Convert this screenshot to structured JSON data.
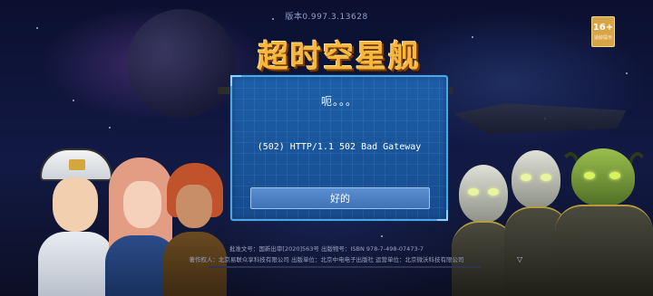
{
  "version_text": "版本0.997.3.13628",
  "age_rating": {
    "label": "16+",
    "sublabel": "适龄提示"
  },
  "game_logo": "超时空星舰",
  "dialog": {
    "title": "呃。。。",
    "message": "(502) HTTP/1.1 502 Bad Gateway",
    "ok_button": "好的"
  },
  "footer": {
    "line1": "批准文号：国新出审[2020]563号 出版物号：ISBN 978-7-498-07473-7",
    "line2": "著作权人：北京易联众享科技有限公司 出版单位：北京中电电子出版社 运营单位：北京微沃科技有限公司"
  },
  "colors": {
    "dialog_bg": "#1d5fa8",
    "dialog_border": "#4fa3e8",
    "button_bg": "#4a80c4",
    "logo": "#f6b73a"
  }
}
